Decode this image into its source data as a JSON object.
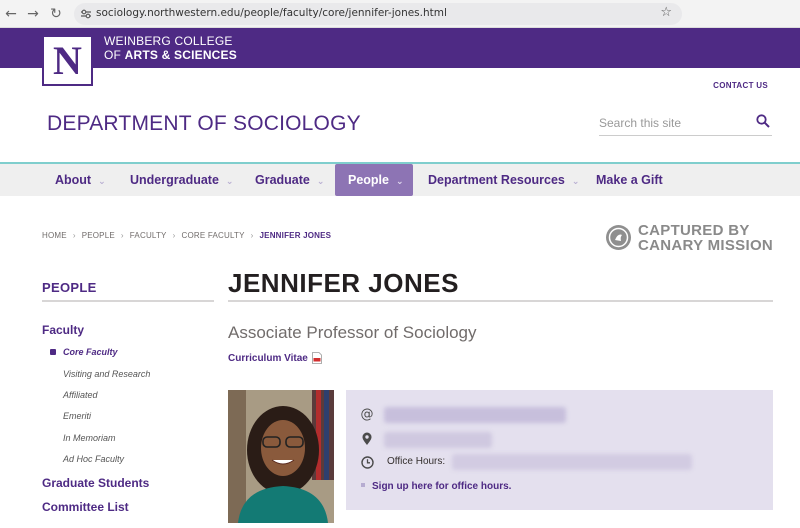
{
  "browser": {
    "url": "sociology.northwestern.edu/people/faculty/core/jennifer-jones.html",
    "back_icon": "arrow-left-icon",
    "forward_icon": "arrow-right-icon",
    "reload_icon": "reload-icon"
  },
  "header": {
    "college_line1": "WEINBERG COLLEGE",
    "college_line2_prefix": "OF ",
    "college_line2_bold": "ARTS & SCIENCES",
    "logo_letter": "N",
    "contact": "CONTACT US",
    "department": "DEPARTMENT OF SOCIOLOGY",
    "search_placeholder": "Search this site"
  },
  "nav": {
    "items": [
      {
        "label": "About",
        "dropdown": true
      },
      {
        "label": "Undergraduate",
        "dropdown": true
      },
      {
        "label": "Graduate",
        "dropdown": true
      },
      {
        "label": "People",
        "dropdown": true,
        "active": true
      },
      {
        "label": "Department Resources",
        "dropdown": true
      },
      {
        "label": "Make a Gift",
        "dropdown": false
      }
    ]
  },
  "breadcrumb": [
    "HOME",
    "PEOPLE",
    "FACULTY",
    "CORE FACULTY",
    "JENNIFER JONES"
  ],
  "watermark": {
    "line1": "CAPTURED BY",
    "line2": "CANARY MISSION"
  },
  "sidebar": {
    "title": "PEOPLE",
    "faculty": "Faculty",
    "sub": [
      "Core Faculty",
      "Visiting and Research",
      "Affiliated",
      "Emeriti",
      "In Memoriam",
      "Ad Hoc Faculty"
    ],
    "items": [
      "Graduate Students",
      "Committee List"
    ]
  },
  "profile": {
    "name": "JENNIFER JONES",
    "title": "Associate Professor of Sociology",
    "cv": "Curriculum Vitae",
    "office_hours_label": "Office Hours:",
    "signup": "Sign up here for office hours."
  },
  "colors": {
    "purple": "#4e2a84",
    "purple_light": "#8d74b4",
    "teal_rule": "#7fcecd",
    "info_bg": "#e4e0ee"
  }
}
